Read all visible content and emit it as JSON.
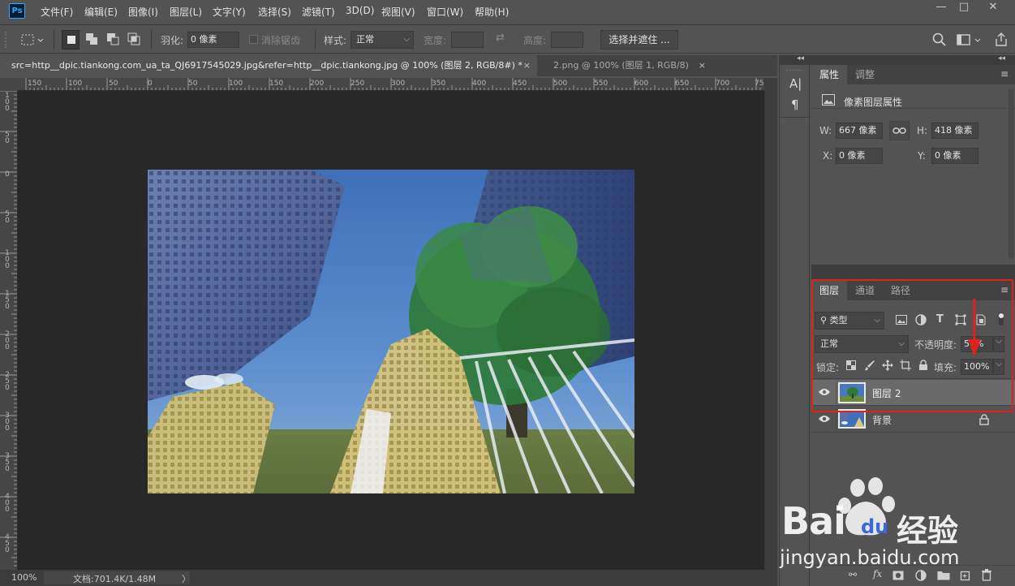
{
  "app": {
    "logo": "Ps",
    "menus": [
      "文件(F)",
      "编辑(E)",
      "图像(I)",
      "图层(L)",
      "文字(Y)",
      "选择(S)",
      "滤镜(T)",
      "3D(D)",
      "视图(V)",
      "窗口(W)",
      "帮助(H)"
    ],
    "window_controls": {
      "minimize": "—",
      "maximize": "□",
      "close": "✕"
    }
  },
  "options": {
    "feather_label": "羽化:",
    "feather_value": "0 像素",
    "antialias_label": "消除锯齿",
    "style_label": "样式:",
    "style_value": "正常",
    "width_label": "宽度:",
    "height_label": "高度:",
    "select_mask_button": "选择并遮住 ..."
  },
  "tabs": [
    {
      "label": "src=http__dpic.tiankong.com_ua_ta_QJ6917545029.jpg&refer=http__dpic.tiankong.jpg @ 100% (图层 2, RGB/8#) *",
      "close": "×"
    },
    {
      "label": "2.png @ 100% (图层 1, RGB/8)",
      "close": "×"
    }
  ],
  "ruler_h": [
    "150",
    "100",
    "50",
    "0",
    "50",
    "100",
    "150",
    "200",
    "250",
    "300",
    "350",
    "400",
    "450",
    "500",
    "550",
    "600",
    "650",
    "700",
    "75"
  ],
  "ruler_v": [
    "1\n0\n0",
    "5\n0",
    "0",
    "5\n0",
    "1\n0\n0",
    "1\n5\n0",
    "2\n0\n0",
    "2\n5\n0",
    "3\n0\n0",
    "3\n5\n0",
    "4\n0\n0",
    "4\n5\n0"
  ],
  "status": {
    "zoom": "100%",
    "doc_info": "文档:701.4K/1.48M",
    "arrow": "〉"
  },
  "strip": {
    "collapse": "◂◂",
    "char_icon": "A|",
    "para_icon": "¶"
  },
  "properties": {
    "tabs": [
      "属性",
      "调整"
    ],
    "title": "像素图层属性",
    "w_label": "W:",
    "w_value": "667 像素",
    "h_label": "H:",
    "h_value": "418 像素",
    "x_label": "X:",
    "x_value": "0 像素",
    "y_label": "Y:",
    "y_value": "0 像素"
  },
  "layers": {
    "tabs": [
      "图层",
      "通道",
      "路径"
    ],
    "filter_value": "类型",
    "blend_mode": "正常",
    "opacity_label": "不透明度:",
    "opacity_value": "50%",
    "lock_label": "锁定:",
    "fill_label": "填充:",
    "fill_value": "100%",
    "items": [
      {
        "name": "图层 2",
        "selected": true
      },
      {
        "name": "背景",
        "selected": false
      }
    ]
  },
  "watermark": {
    "brand": "Bai",
    "brand2": "du",
    "cn": "经验",
    "url": "jingyan.baidu.com"
  },
  "colors": {
    "accent_red": "#e0221d",
    "ps_blue": "#31a8ff"
  }
}
